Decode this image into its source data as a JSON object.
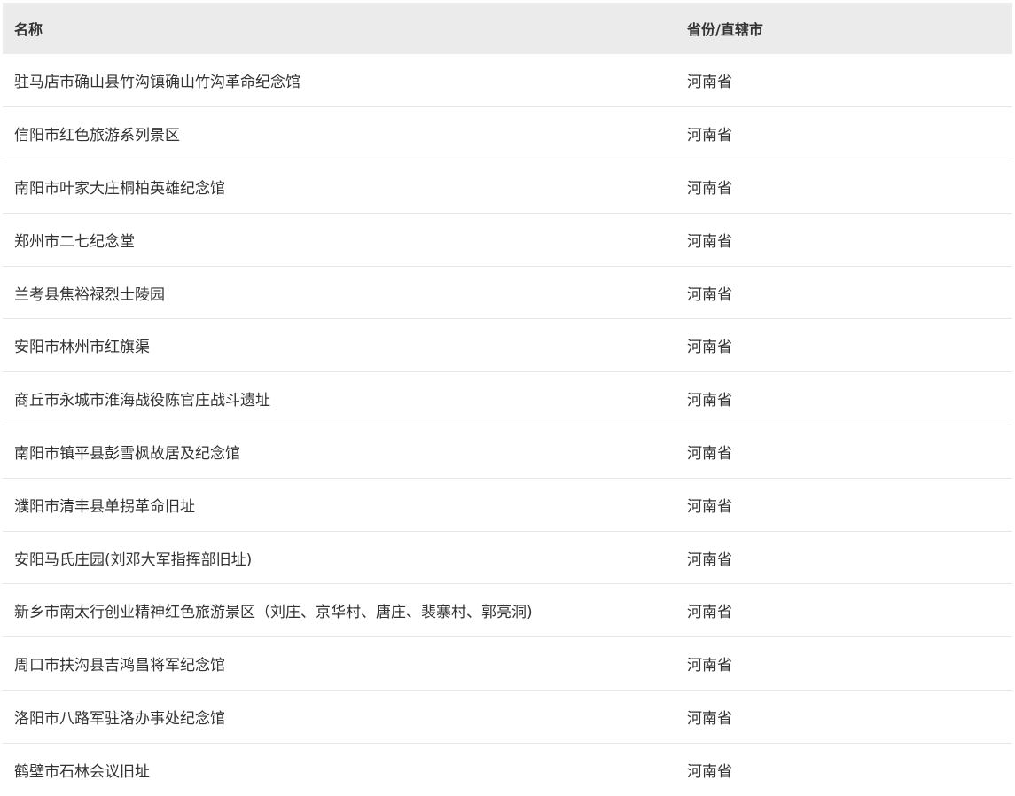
{
  "table": {
    "headers": {
      "name": "名称",
      "province": "省份/直辖市"
    },
    "rows": [
      {
        "name": "驻马店市确山县竹沟镇确山竹沟革命纪念馆",
        "province": "河南省"
      },
      {
        "name": "信阳市红色旅游系列景区",
        "province": "河南省"
      },
      {
        "name": "南阳市叶家大庄桐柏英雄纪念馆",
        "province": "河南省"
      },
      {
        "name": "郑州市二七纪念堂",
        "province": "河南省"
      },
      {
        "name": "兰考县焦裕禄烈士陵园",
        "province": "河南省"
      },
      {
        "name": "安阳市林州市红旗渠",
        "province": "河南省"
      },
      {
        "name": "商丘市永城市淮海战役陈官庄战斗遗址",
        "province": "河南省"
      },
      {
        "name": "南阳市镇平县彭雪枫故居及纪念馆",
        "province": "河南省"
      },
      {
        "name": "濮阳市清丰县单拐革命旧址",
        "province": "河南省"
      },
      {
        "name": "安阳马氏庄园(刘邓大军指挥部旧址)",
        "province": "河南省"
      },
      {
        "name": "新乡市南太行创业精神红色旅游景区（刘庄、京华村、唐庄、裴寨村、郭亮洞)",
        "province": "河南省"
      },
      {
        "name": "周口市扶沟县吉鸿昌将军纪念馆",
        "province": "河南省"
      },
      {
        "name": "洛阳市八路军驻洛办事处纪念馆",
        "province": "河南省"
      },
      {
        "name": "鹤壁市石林会议旧址",
        "province": "河南省"
      }
    ]
  }
}
